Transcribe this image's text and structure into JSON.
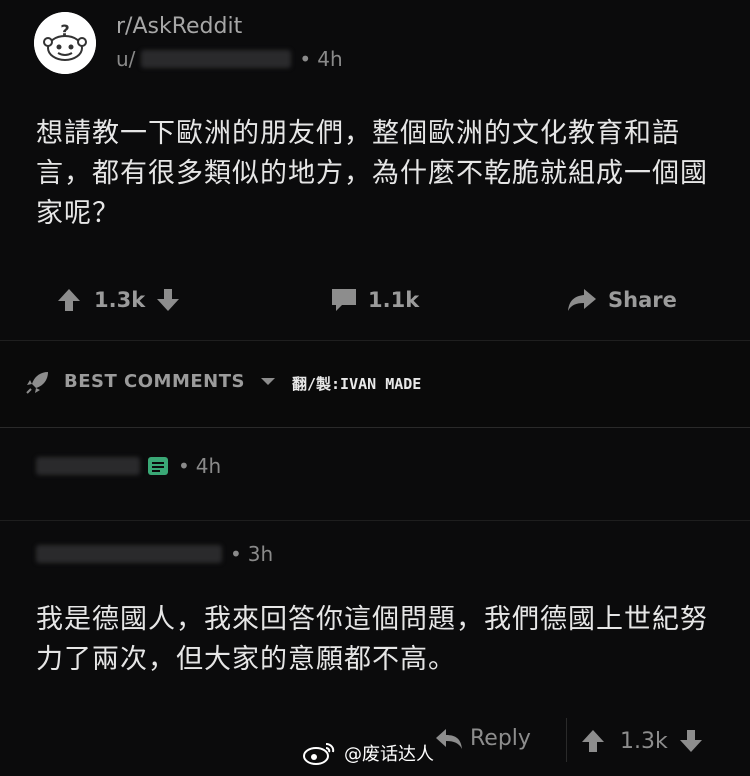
{
  "post": {
    "subreddit": "r/AskReddit",
    "user_prefix": "u/",
    "time": "4h",
    "body": "想請教一下歐洲的朋友們，整個歐洲的文化教育和語言，都有很多類似的地方，為什麼不乾脆就組成一個國家呢？",
    "upvotes": "1.3k",
    "comments": "1.1k",
    "share_label": "Share"
  },
  "comments_section": {
    "sort_label": "BEST COMMENTS",
    "credit": "翻/製:IVAN MADE"
  },
  "comment1": {
    "time": "4h"
  },
  "comment2": {
    "time": "3h",
    "body": "我是德國人，我來回答你這個問題，我們德國上世紀努力了兩次，但大家的意願都不高。",
    "reply_label": "Reply",
    "upvotes": "1.3k"
  },
  "watermark": {
    "text": "@废话达人"
  },
  "colors": {
    "background": "#0b0b0c",
    "text": "#e6e6e6",
    "muted": "#9b9b9b",
    "badge_green": "#3aa876"
  }
}
